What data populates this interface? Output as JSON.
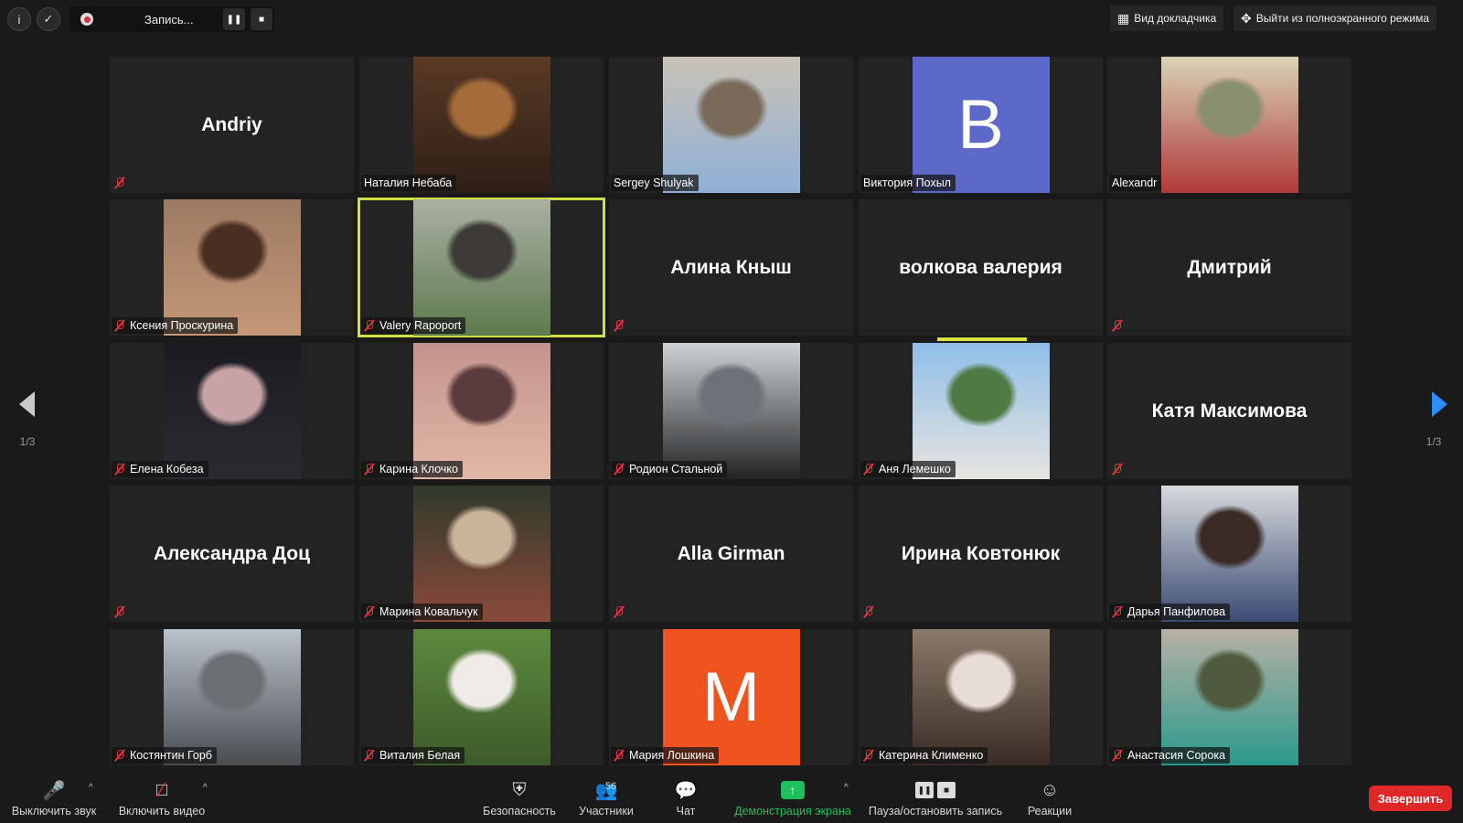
{
  "topbar": {
    "recording_label": "Запись...",
    "speaker_view_label": "Вид докладчика",
    "exit_fullscreen_label": "Выйти из полноэкранного режима"
  },
  "tiles": [
    {
      "name": "Andriy",
      "kind": "name",
      "muted": true
    },
    {
      "name": "Наталия Небаба",
      "kind": "video",
      "muted": false,
      "colors": [
        "#5a3a24",
        "#a56b3a",
        "#2e1f17"
      ]
    },
    {
      "name": "Sergey Shulyak",
      "kind": "video",
      "muted": false,
      "colors": [
        "#c9c2b6",
        "#7a6a5a",
        "#8fb0d6"
      ]
    },
    {
      "name": "Виктория Похыл",
      "kind": "avatar",
      "muted": false,
      "letter": "B",
      "color": "#5d69c8"
    },
    {
      "name": "Alexandr",
      "kind": "video",
      "muted": false,
      "colors": [
        "#d9d3b6",
        "#8a8f6f",
        "#b03a3a"
      ]
    },
    {
      "name": "Ксения Проскурина",
      "kind": "video",
      "muted": true,
      "colors": [
        "#9d7a62",
        "#4a2e22",
        "#c49878"
      ]
    },
    {
      "name": "Valery Rapoport",
      "kind": "video",
      "muted": true,
      "active": true,
      "colors": [
        "#a9b0a2",
        "#3d3a38",
        "#5e7a4e"
      ]
    },
    {
      "name": "Алина Кныш",
      "kind": "name",
      "muted": true
    },
    {
      "name": "волкова валерия",
      "kind": "name",
      "muted": false
    },
    {
      "name": "Дмитрий",
      "kind": "name",
      "muted": true
    },
    {
      "name": "Елена Кобеза",
      "kind": "video",
      "muted": true,
      "colors": [
        "#1b1c22",
        "#c7a3a6",
        "#2c2a30"
      ]
    },
    {
      "name": "Карина Клочко",
      "kind": "video",
      "muted": true,
      "colors": [
        "#c3948d",
        "#5a3b3e",
        "#e0b7a5"
      ]
    },
    {
      "name": "Родион Стальной",
      "kind": "video",
      "muted": true,
      "colors": [
        "#cfd2d4",
        "#6c7278",
        "#222426"
      ]
    },
    {
      "name": "Аня Лемешко",
      "kind": "video",
      "muted": true,
      "colors": [
        "#8fbfe8",
        "#4f7a43",
        "#e7e4e0"
      ]
    },
    {
      "name": "Катя Максимова",
      "kind": "name",
      "muted": true
    },
    {
      "name": "Александра Доц",
      "kind": "name",
      "muted": true
    },
    {
      "name": "Марина Ковальчук",
      "kind": "video",
      "muted": true,
      "colors": [
        "#2f3a2c",
        "#c9b49a",
        "#8b4a3a"
      ]
    },
    {
      "name": "Alla Girman",
      "kind": "name",
      "muted": true
    },
    {
      "name": "Ирина Ковтонюк",
      "kind": "name",
      "muted": true
    },
    {
      "name": "Дарья Панфилова",
      "kind": "video",
      "muted": true,
      "colors": [
        "#d7d9dc",
        "#3a2b26",
        "#3b4b73"
      ]
    },
    {
      "name": "Костянтин Горб",
      "kind": "video",
      "muted": true,
      "colors": [
        "#b9c2c8",
        "#6b6e72",
        "#4a4d52"
      ]
    },
    {
      "name": "Виталия Белая",
      "kind": "video",
      "muted": true,
      "colors": [
        "#5d8a3e",
        "#eeeae6",
        "#3d5b2a"
      ]
    },
    {
      "name": "Мария Лошкина",
      "kind": "avatar",
      "muted": true,
      "letter": "M",
      "color": "#f0541e"
    },
    {
      "name": "Катерина Клименко",
      "kind": "video",
      "muted": true,
      "colors": [
        "#8a7a6a",
        "#e8dcd6",
        "#3a2c26"
      ]
    },
    {
      "name": "Анастасия Сорока",
      "kind": "video",
      "muted": true,
      "colors": [
        "#b8b0a4",
        "#4f5a3e",
        "#2a9a8c"
      ]
    }
  ],
  "pagination": {
    "left": "1/3",
    "right": "1/3"
  },
  "bottombar": {
    "mute_label": "Выключить звук",
    "video_label": "Включить видео",
    "security_label": "Безопасность",
    "participants_label": "Участники",
    "participants_count": "56",
    "chat_label": "Чат",
    "share_label": "Демонстрация экрана",
    "record_label": "Пауза/остановить запись",
    "reactions_label": "Реакции",
    "end_label": "Завершить"
  }
}
